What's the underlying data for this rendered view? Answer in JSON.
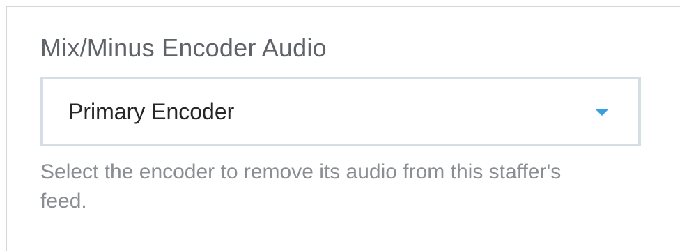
{
  "field": {
    "label": "Mix/Minus Encoder Audio",
    "select": {
      "value": "Primary Encoder",
      "icon": "chevron-down-icon",
      "accent_color": "#3a9fe0"
    },
    "help_text": "Select the encoder to remove its audio from this staffer's feed."
  }
}
